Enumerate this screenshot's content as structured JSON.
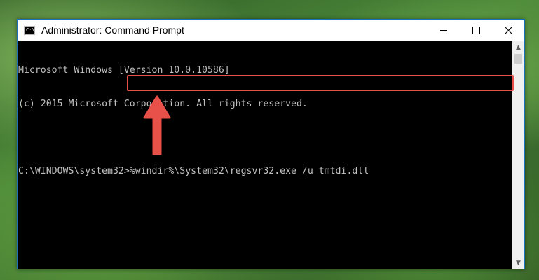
{
  "window": {
    "title": "Administrator: Command Prompt",
    "icon": "cmd-icon",
    "controls": {
      "minimize": "minimize-icon",
      "maximize": "maximize-icon",
      "close": "close-icon"
    }
  },
  "console": {
    "lines": [
      "Microsoft Windows [Version 10.0.10586]",
      "(c) 2015 Microsoft Corporotion. All rights reserved.",
      ""
    ],
    "prompt": "C:\\WINDOWS\\system32>",
    "command": "%windir%\\System32\\regsvr32.exe /u tmtdi.dll"
  },
  "annotations": {
    "highlight_color": "#e8504a",
    "arrow_color": "#e8504a"
  }
}
